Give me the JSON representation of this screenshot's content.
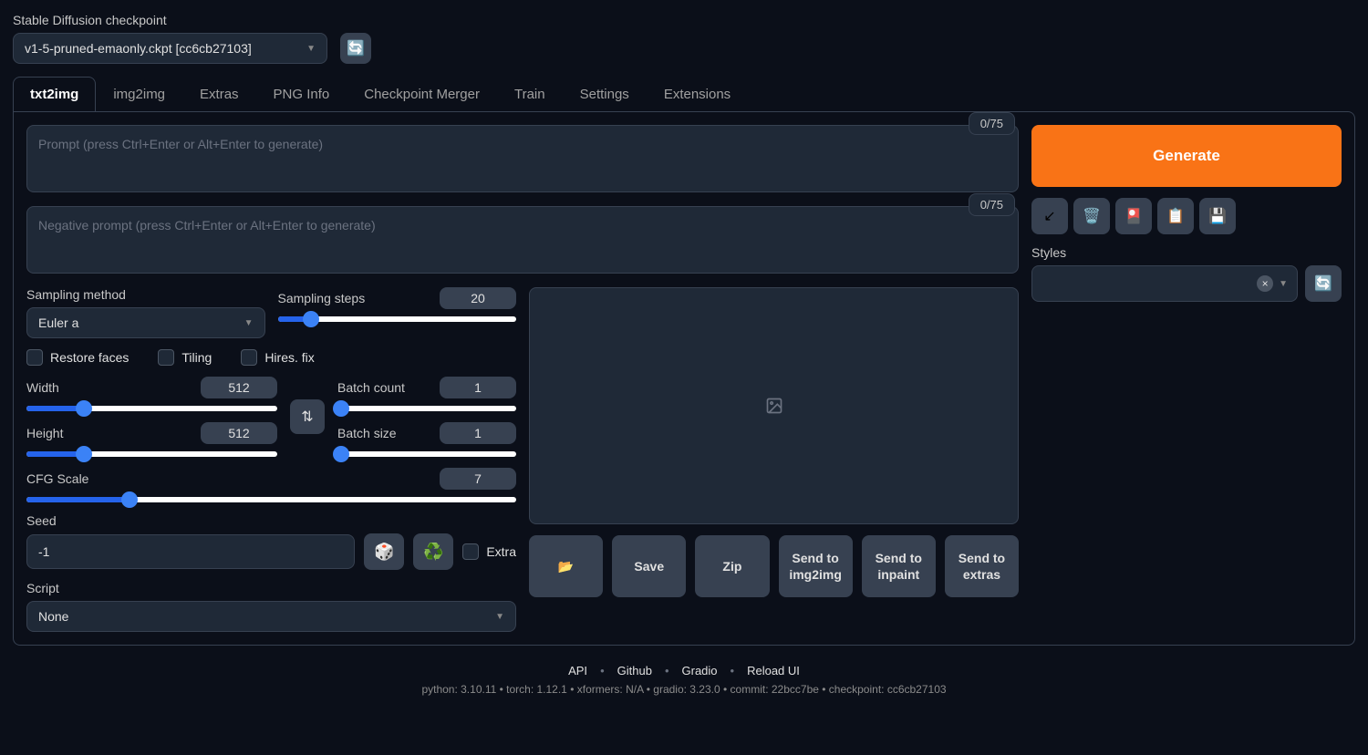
{
  "checkpoint": {
    "label": "Stable Diffusion checkpoint",
    "value": "v1-5-pruned-emaonly.ckpt [cc6cb27103]"
  },
  "tabs": [
    "txt2img",
    "img2img",
    "Extras",
    "PNG Info",
    "Checkpoint Merger",
    "Train",
    "Settings",
    "Extensions"
  ],
  "prompt": {
    "placeholder": "Prompt (press Ctrl+Enter or Alt+Enter to generate)",
    "tokens": "0/75"
  },
  "neg_prompt": {
    "placeholder": "Negative prompt (press Ctrl+Enter or Alt+Enter to generate)",
    "tokens": "0/75"
  },
  "generate_label": "Generate",
  "styles_label": "Styles",
  "sampling_method": {
    "label": "Sampling method",
    "value": "Euler a"
  },
  "sampling_steps": {
    "label": "Sampling steps",
    "value": "20"
  },
  "checks": {
    "restore_faces": "Restore faces",
    "tiling": "Tiling",
    "hires_fix": "Hires. fix"
  },
  "width": {
    "label": "Width",
    "value": "512"
  },
  "height": {
    "label": "Height",
    "value": "512"
  },
  "batch_count": {
    "label": "Batch count",
    "value": "1"
  },
  "batch_size": {
    "label": "Batch size",
    "value": "1"
  },
  "cfg": {
    "label": "CFG Scale",
    "value": "7"
  },
  "seed": {
    "label": "Seed",
    "value": "-1"
  },
  "extra_label": "Extra",
  "script": {
    "label": "Script",
    "value": "None"
  },
  "out_buttons": {
    "save": "Save",
    "zip": "Zip",
    "send_img2img": "Send to img2img",
    "send_inpaint": "Send to inpaint",
    "send_extras": "Send to extras"
  },
  "footer": {
    "links": [
      "API",
      "Github",
      "Gradio",
      "Reload UI"
    ],
    "meta": "python: 3.10.11  •  torch: 1.12.1  •  xformers: N/A  •  gradio: 3.23.0  •  commit: 22bcc7be  •  checkpoint: cc6cb27103"
  }
}
